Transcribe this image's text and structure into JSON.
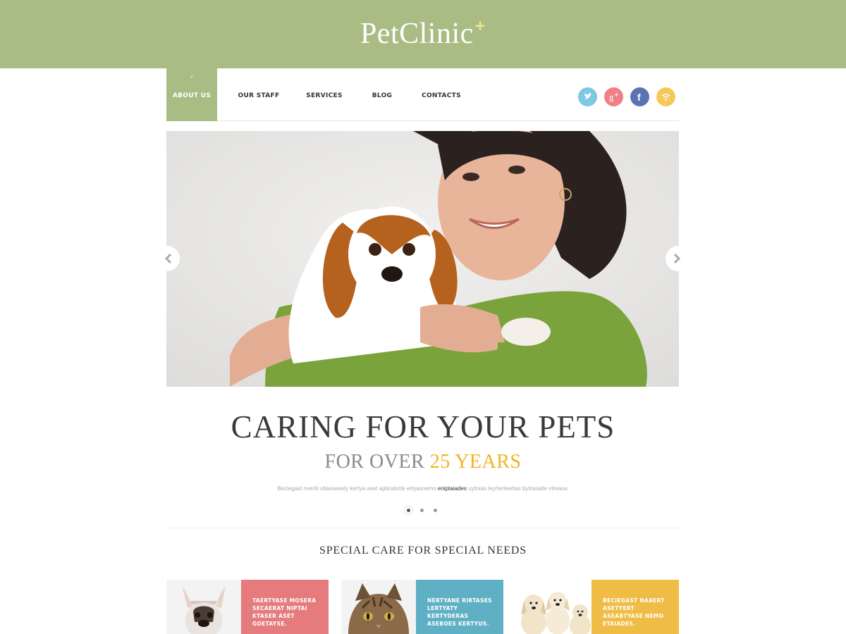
{
  "header": {
    "logo_text": "PetClinic",
    "logo_plus": "+",
    "colors": {
      "brand_green": "#a8bc84",
      "accent_yellow": "#f2b320"
    }
  },
  "nav": {
    "items": [
      {
        "label": "ABOUT US",
        "active": true
      },
      {
        "label": "OUR STAFF",
        "active": false
      },
      {
        "label": "SERVICES",
        "active": false
      },
      {
        "label": "BLOG",
        "active": false
      },
      {
        "label": "CONTACTS",
        "active": false
      }
    ],
    "active_caret": "˅",
    "social": [
      {
        "icon": "twitter-icon",
        "color": "#7ec8e3"
      },
      {
        "icon": "google-plus-icon",
        "color": "#f07f86"
      },
      {
        "icon": "facebook-icon",
        "color": "#5a73b5"
      },
      {
        "icon": "rss-icon",
        "color": "#f5c85a"
      }
    ]
  },
  "hero": {
    "image": "woman-holding-spaniel-dog-photo",
    "prev_icon": "chevron-left-icon",
    "next_icon": "chevron-right-icon",
    "headline": "CARING FOR YOUR PETS",
    "sub_prefix": "FOR OVER ",
    "sub_accent": "25 YEARS",
    "desc_before": "Beciegast nveriti vitaesasety kertya aset aplicabrde ertyasnemo ",
    "desc_highlight": "eniptaiades",
    "desc_after": " uytrsas leyrterteertas bytrasade vtreasa.",
    "slides_total": 3,
    "slide_active": 1
  },
  "section": {
    "title": "SPECIAL CARE FOR SPECIAL NEEDS"
  },
  "cards": [
    {
      "image": "french-bulldog-photo",
      "text": "TAERTYASE MOSERA SECAERAT NIPTAI KTASER ASET GOETAYSE.",
      "color": "#e57b7d"
    },
    {
      "image": "tabby-cat-photo",
      "text": "NERTYANE RIRTASES LERTYATY KERTYDERAS ASEBOES KERTYUS.",
      "color": "#5fb0c4"
    },
    {
      "image": "puppies-photo",
      "text": "BECIEGAST NAAERT ASETYERT ASEABTYASE NEMO ETAIADES.",
      "color": "#efbc45"
    }
  ]
}
